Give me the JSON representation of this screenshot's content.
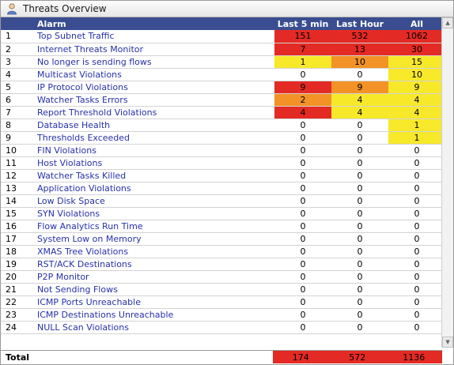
{
  "panel": {
    "title": "Threats Overview",
    "title_icon": "user-shield-icon"
  },
  "table": {
    "headers": {
      "alarm": "Alarm",
      "last5": "Last 5 min",
      "lasthour": "Last Hour",
      "all": "All"
    },
    "colors": {
      "red": "#e42a24",
      "orange": "#f39226",
      "yellow": "#f7e92a",
      "header_bg": "#3a4d91",
      "link_text": "#2631a8"
    },
    "rows": [
      {
        "num": "1",
        "alarm": "Top Subnet Traffic",
        "last5": "151",
        "lasthour": "532",
        "all": "1062",
        "c5": "red",
        "ch": "red",
        "ca": "red"
      },
      {
        "num": "2",
        "alarm": "Internet Threats Monitor",
        "last5": "7",
        "lasthour": "13",
        "all": "30",
        "c5": "red",
        "ch": "red",
        "ca": "red"
      },
      {
        "num": "3",
        "alarm": "No longer is sending flows",
        "last5": "1",
        "lasthour": "10",
        "all": "15",
        "c5": "yellow",
        "ch": "orange",
        "ca": "yellow"
      },
      {
        "num": "4",
        "alarm": "Multicast Violations",
        "last5": "0",
        "lasthour": "0",
        "all": "10",
        "c5": "",
        "ch": "",
        "ca": "yellow"
      },
      {
        "num": "5",
        "alarm": "IP Protocol Violations",
        "last5": "9",
        "lasthour": "9",
        "all": "9",
        "c5": "red",
        "ch": "orange",
        "ca": "yellow"
      },
      {
        "num": "6",
        "alarm": "Watcher Tasks Errors",
        "last5": "2",
        "lasthour": "4",
        "all": "4",
        "c5": "orange",
        "ch": "yellow",
        "ca": "yellow"
      },
      {
        "num": "7",
        "alarm": "Report Threshold Violations",
        "last5": "4",
        "lasthour": "4",
        "all": "4",
        "c5": "red",
        "ch": "yellow",
        "ca": "yellow"
      },
      {
        "num": "8",
        "alarm": "Database Health",
        "last5": "0",
        "lasthour": "0",
        "all": "1",
        "c5": "",
        "ch": "",
        "ca": "yellow"
      },
      {
        "num": "9",
        "alarm": "Thresholds Exceeded",
        "last5": "0",
        "lasthour": "0",
        "all": "1",
        "c5": "",
        "ch": "",
        "ca": "yellow"
      },
      {
        "num": "10",
        "alarm": "FIN Violations",
        "last5": "0",
        "lasthour": "0",
        "all": "0",
        "c5": "",
        "ch": "",
        "ca": ""
      },
      {
        "num": "11",
        "alarm": "Host Violations",
        "last5": "0",
        "lasthour": "0",
        "all": "0",
        "c5": "",
        "ch": "",
        "ca": ""
      },
      {
        "num": "12",
        "alarm": "Watcher Tasks Killed",
        "last5": "0",
        "lasthour": "0",
        "all": "0",
        "c5": "",
        "ch": "",
        "ca": ""
      },
      {
        "num": "13",
        "alarm": "Application Violations",
        "last5": "0",
        "lasthour": "0",
        "all": "0",
        "c5": "",
        "ch": "",
        "ca": ""
      },
      {
        "num": "14",
        "alarm": "Low Disk Space",
        "last5": "0",
        "lasthour": "0",
        "all": "0",
        "c5": "",
        "ch": "",
        "ca": ""
      },
      {
        "num": "15",
        "alarm": "SYN Violations",
        "last5": "0",
        "lasthour": "0",
        "all": "0",
        "c5": "",
        "ch": "",
        "ca": ""
      },
      {
        "num": "16",
        "alarm": "Flow Analytics Run Time",
        "last5": "0",
        "lasthour": "0",
        "all": "0",
        "c5": "",
        "ch": "",
        "ca": ""
      },
      {
        "num": "17",
        "alarm": "System Low on Memory",
        "last5": "0",
        "lasthour": "0",
        "all": "0",
        "c5": "",
        "ch": "",
        "ca": ""
      },
      {
        "num": "18",
        "alarm": "XMAS Tree Violations",
        "last5": "0",
        "lasthour": "0",
        "all": "0",
        "c5": "",
        "ch": "",
        "ca": ""
      },
      {
        "num": "19",
        "alarm": "RST/ACK Destinations",
        "last5": "0",
        "lasthour": "0",
        "all": "0",
        "c5": "",
        "ch": "",
        "ca": ""
      },
      {
        "num": "20",
        "alarm": "P2P Monitor",
        "last5": "0",
        "lasthour": "0",
        "all": "0",
        "c5": "",
        "ch": "",
        "ca": ""
      },
      {
        "num": "21",
        "alarm": "Not Sending Flows",
        "last5": "0",
        "lasthour": "0",
        "all": "0",
        "c5": "",
        "ch": "",
        "ca": ""
      },
      {
        "num": "22",
        "alarm": "ICMP Ports Unreachable",
        "last5": "0",
        "lasthour": "0",
        "all": "0",
        "c5": "",
        "ch": "",
        "ca": ""
      },
      {
        "num": "23",
        "alarm": "ICMP Destinations Unreachable",
        "last5": "0",
        "lasthour": "0",
        "all": "0",
        "c5": "",
        "ch": "",
        "ca": ""
      },
      {
        "num": "24",
        "alarm": "NULL Scan Violations",
        "last5": "0",
        "lasthour": "0",
        "all": "0",
        "c5": "",
        "ch": "",
        "ca": ""
      }
    ],
    "total": {
      "label": "Total",
      "last5": "174",
      "lasthour": "572",
      "all": "1136"
    }
  },
  "scrollbar": {
    "up_icon": "scroll-up-arrow-icon",
    "down_icon": "scroll-down-arrow-icon"
  }
}
